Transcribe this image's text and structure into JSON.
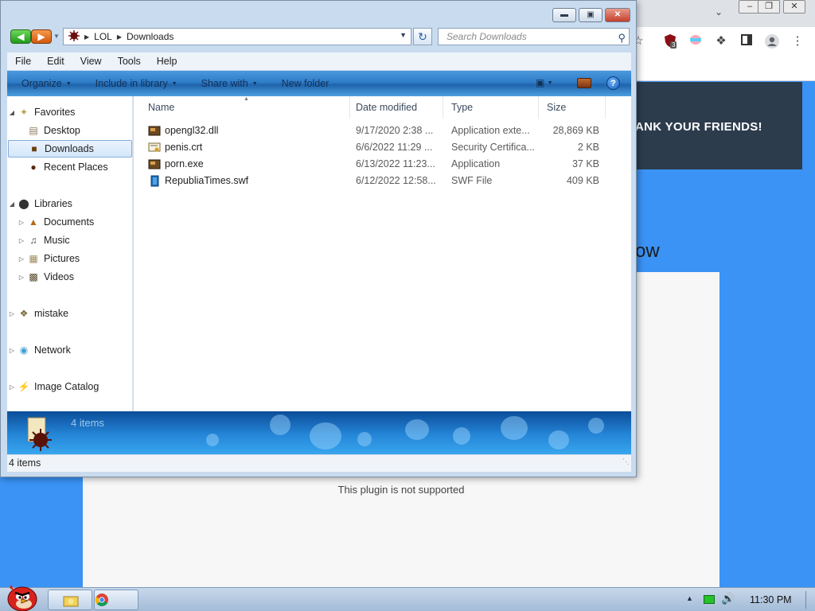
{
  "browser": {
    "header_banner": "ANK YOUR FRIENDS!",
    "partial_heading": "ow",
    "plugin_message": "This plugin is not supported",
    "extension_badge": "3"
  },
  "explorer": {
    "breadcrumb": [
      "LOL",
      "Downloads"
    ],
    "search_placeholder": "Search Downloads",
    "menu": [
      "File",
      "Edit",
      "View",
      "Tools",
      "Help"
    ],
    "commands": {
      "organize": "Organize",
      "include_in_library": "Include in library",
      "share_with": "Share with",
      "new_folder": "New folder"
    },
    "nav": {
      "favorites": "Favorites",
      "desktop": "Desktop",
      "downloads": "Downloads",
      "recent_places": "Recent Places",
      "libraries": "Libraries",
      "documents": "Documents",
      "music": "Music",
      "pictures": "Pictures",
      "videos": "Videos",
      "mistake": "mistake",
      "network": "Network",
      "image_catalog": "Image Catalog"
    },
    "columns": {
      "name": "Name",
      "date_modified": "Date modified",
      "type": "Type",
      "size": "Size"
    },
    "files": [
      {
        "name": "opengl32.dll",
        "date": "9/17/2020 2:38 ...",
        "type": "Application exte...",
        "size": "28,869 KB",
        "icon": "dll-file-icon"
      },
      {
        "name": "penis.crt",
        "date": "6/6/2022 11:29 ...",
        "type": "Security Certifica...",
        "size": "2 KB",
        "icon": "certificate-file-icon"
      },
      {
        "name": "porn.exe",
        "date": "6/13/2022 11:23...",
        "type": "Application",
        "size": "37 KB",
        "icon": "exe-file-icon"
      },
      {
        "name": "RepubliaTimes.swf",
        "date": "6/12/2022 12:58...",
        "type": "SWF File",
        "size": "409 KB",
        "icon": "swf-file-icon"
      }
    ],
    "details_count": "4 items",
    "status_count": "4 items"
  },
  "taskbar": {
    "clock": "11:30 PM"
  },
  "colors": {
    "page_blue": "#3a93f5",
    "site_header": "#2d3c4d",
    "command_bar": "#2f7cc8",
    "selection": "#d4e6fb"
  }
}
